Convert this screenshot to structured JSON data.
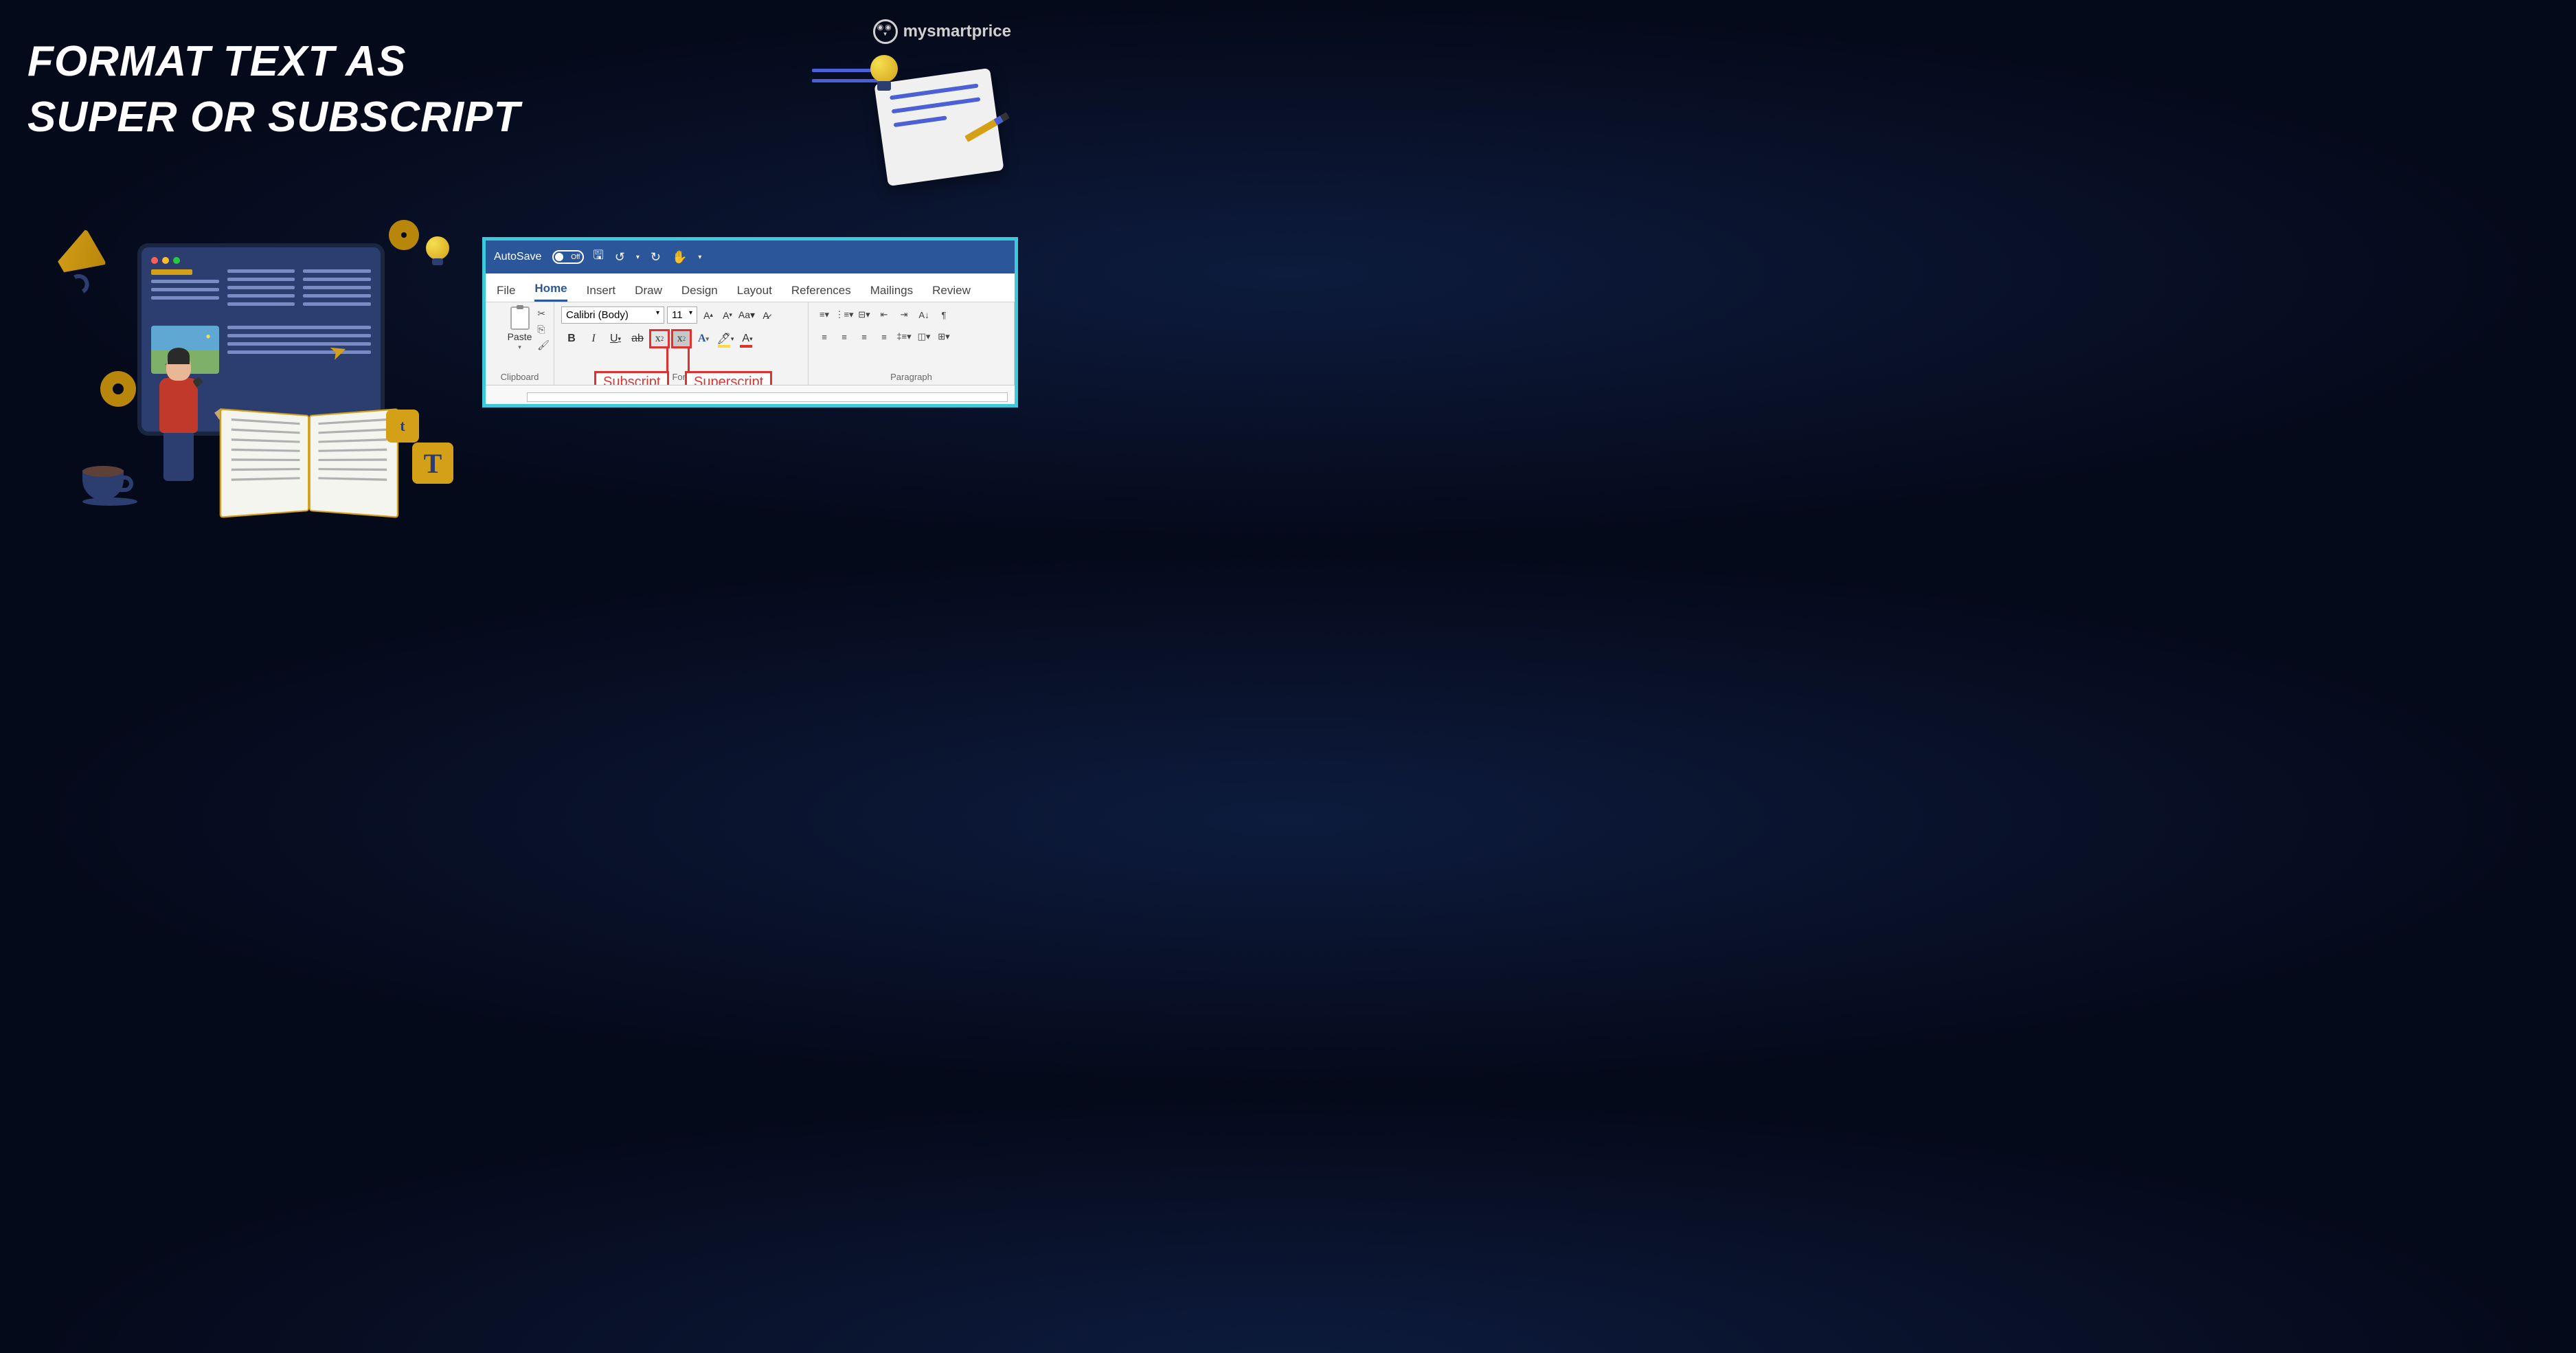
{
  "headline_line1": "FORMAT TEXT AS",
  "headline_line2": "SUPER OR SUBSCRIPT",
  "logo": "mysmartprice",
  "word": {
    "autosave": {
      "label": "AutoSave",
      "state": "Off"
    },
    "tabs": [
      "File",
      "Home",
      "Insert",
      "Draw",
      "Design",
      "Layout",
      "References",
      "Mailings",
      "Review"
    ],
    "active_tab": "Home",
    "clipboard": {
      "paste": "Paste",
      "group": "Clipboard"
    },
    "font": {
      "name": "Calibri (Body)",
      "size": "11",
      "group": "Font"
    },
    "paragraph": {
      "group": "Paragraph"
    },
    "annotations": {
      "subscript": "Subscript",
      "superscript": "Superscript"
    }
  }
}
